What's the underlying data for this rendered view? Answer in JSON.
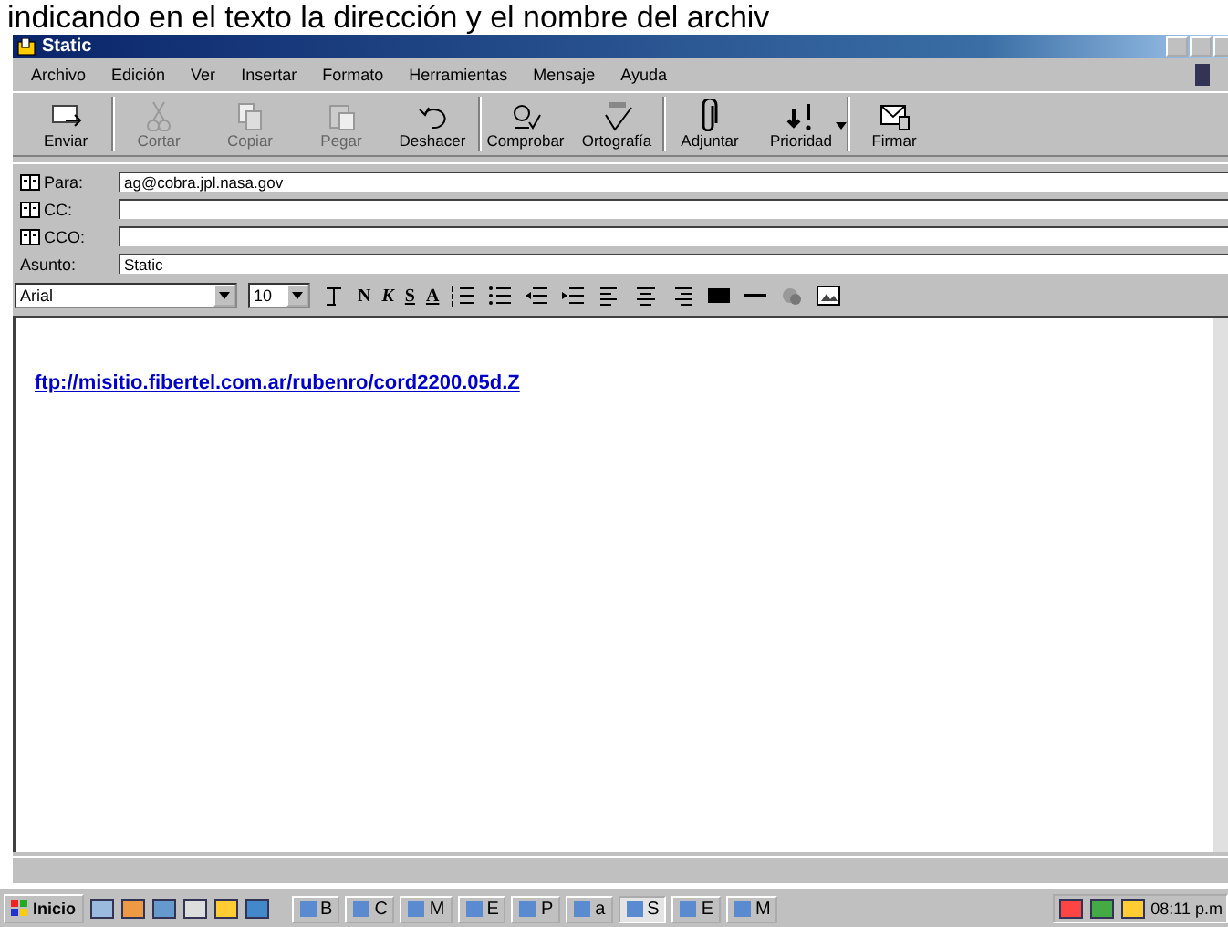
{
  "caption": "indicando en el texto la dirección y el nombre del archiv",
  "window": {
    "title": "Static"
  },
  "menu": [
    {
      "label": "Archivo"
    },
    {
      "label": "Edición"
    },
    {
      "label": "Ver"
    },
    {
      "label": "Insertar"
    },
    {
      "label": "Formato"
    },
    {
      "label": "Herramientas"
    },
    {
      "label": "Mensaje"
    },
    {
      "label": "Ayuda"
    }
  ],
  "toolbar": [
    {
      "label": "Enviar",
      "kind": "send",
      "disabled": false
    },
    {
      "label": "Cortar",
      "kind": "cut",
      "disabled": true
    },
    {
      "label": "Copiar",
      "kind": "copy",
      "disabled": true
    },
    {
      "label": "Pegar",
      "kind": "paste",
      "disabled": true
    },
    {
      "label": "Deshacer",
      "kind": "undo",
      "disabled": false
    },
    {
      "label": "Comprobar",
      "kind": "check",
      "disabled": false
    },
    {
      "label": "Ortografía",
      "kind": "spell",
      "disabled": false
    },
    {
      "label": "Adjuntar",
      "kind": "attach",
      "disabled": false
    },
    {
      "label": "Prioridad",
      "kind": "priority",
      "disabled": false
    },
    {
      "label": "Firmar",
      "kind": "sign",
      "disabled": false
    }
  ],
  "fields": [
    {
      "label": "Para:",
      "kind": "book",
      "value": "ag@cobra.jpl.nasa.gov"
    },
    {
      "label": "CC:",
      "kind": "book"
    },
    {
      "label": "CCO:",
      "kind": "book"
    },
    {
      "label": "Asunto:",
      "kind": "plain",
      "value": "Static"
    }
  ],
  "format": {
    "font": "Arial",
    "size": "10",
    "styles": [
      "N",
      "K",
      "S",
      "A"
    ]
  },
  "body": {
    "link": "ftp://misitio.fibertel.com.ar/rubenro/cord2200.05d.Z"
  },
  "taskbar": {
    "start": "Inicio",
    "tasks": [
      {
        "label": "B",
        "selected": false
      },
      {
        "label": "C",
        "selected": false
      },
      {
        "label": "M",
        "selected": false
      },
      {
        "label": "E",
        "selected": false
      },
      {
        "label": "P",
        "selected": false
      },
      {
        "label": "a",
        "selected": false
      },
      {
        "label": "S",
        "selected": true
      },
      {
        "label": "E",
        "selected": false
      },
      {
        "label": "M",
        "selected": false
      }
    ],
    "clock": "08:11 p.m"
  }
}
